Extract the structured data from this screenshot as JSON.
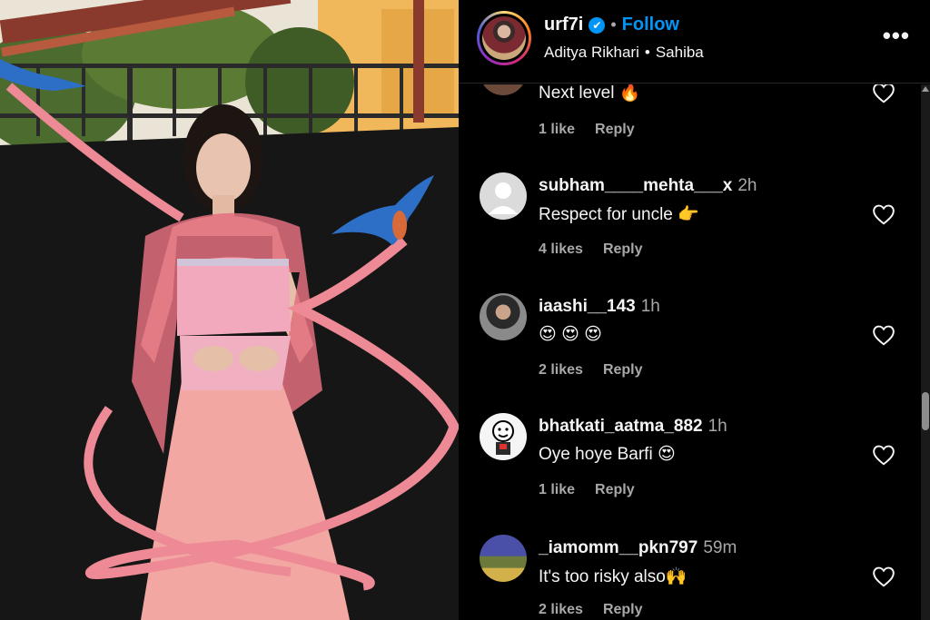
{
  "header": {
    "username": "urf7i",
    "verified_mark": "✔",
    "separator": "•",
    "follow_label": "Follow",
    "artist": "Aditya Rikhari",
    "song_separator": "•",
    "song": "Sahiba",
    "more_label": "•••"
  },
  "comments": [
    {
      "username": "",
      "time": "",
      "text": "Next level 🔥",
      "likes": "1 like",
      "reply": "Reply",
      "avatar_icon": "partial-avatar-icon"
    },
    {
      "username": "subham____mehta___x",
      "time": "2h",
      "text": "Respect for uncle 👉",
      "likes": "4 likes",
      "reply": "Reply",
      "avatar_icon": "default-avatar-icon"
    },
    {
      "username": "iaashi__143",
      "time": "1h",
      "text": "😍 😍 😍",
      "likes": "2 likes",
      "reply": "Reply",
      "avatar_icon": "photo-avatar-icon"
    },
    {
      "username": "bhatkati_aatma_882",
      "time": "1h",
      "text": "Oye hoye Barfi 😍",
      "likes": "1 like",
      "reply": "Reply",
      "avatar_icon": "cartoon-avatar-icon"
    },
    {
      "username": "_iamomm__pkn797",
      "time": "59m",
      "text": "It's too risky also🙌",
      "likes": "2 likes",
      "reply": "Reply",
      "avatar_icon": "photo-avatar-icon"
    }
  ],
  "colors": {
    "follow_blue": "#0095f6",
    "background": "#000000",
    "muted_text": "#a8a8a8"
  }
}
